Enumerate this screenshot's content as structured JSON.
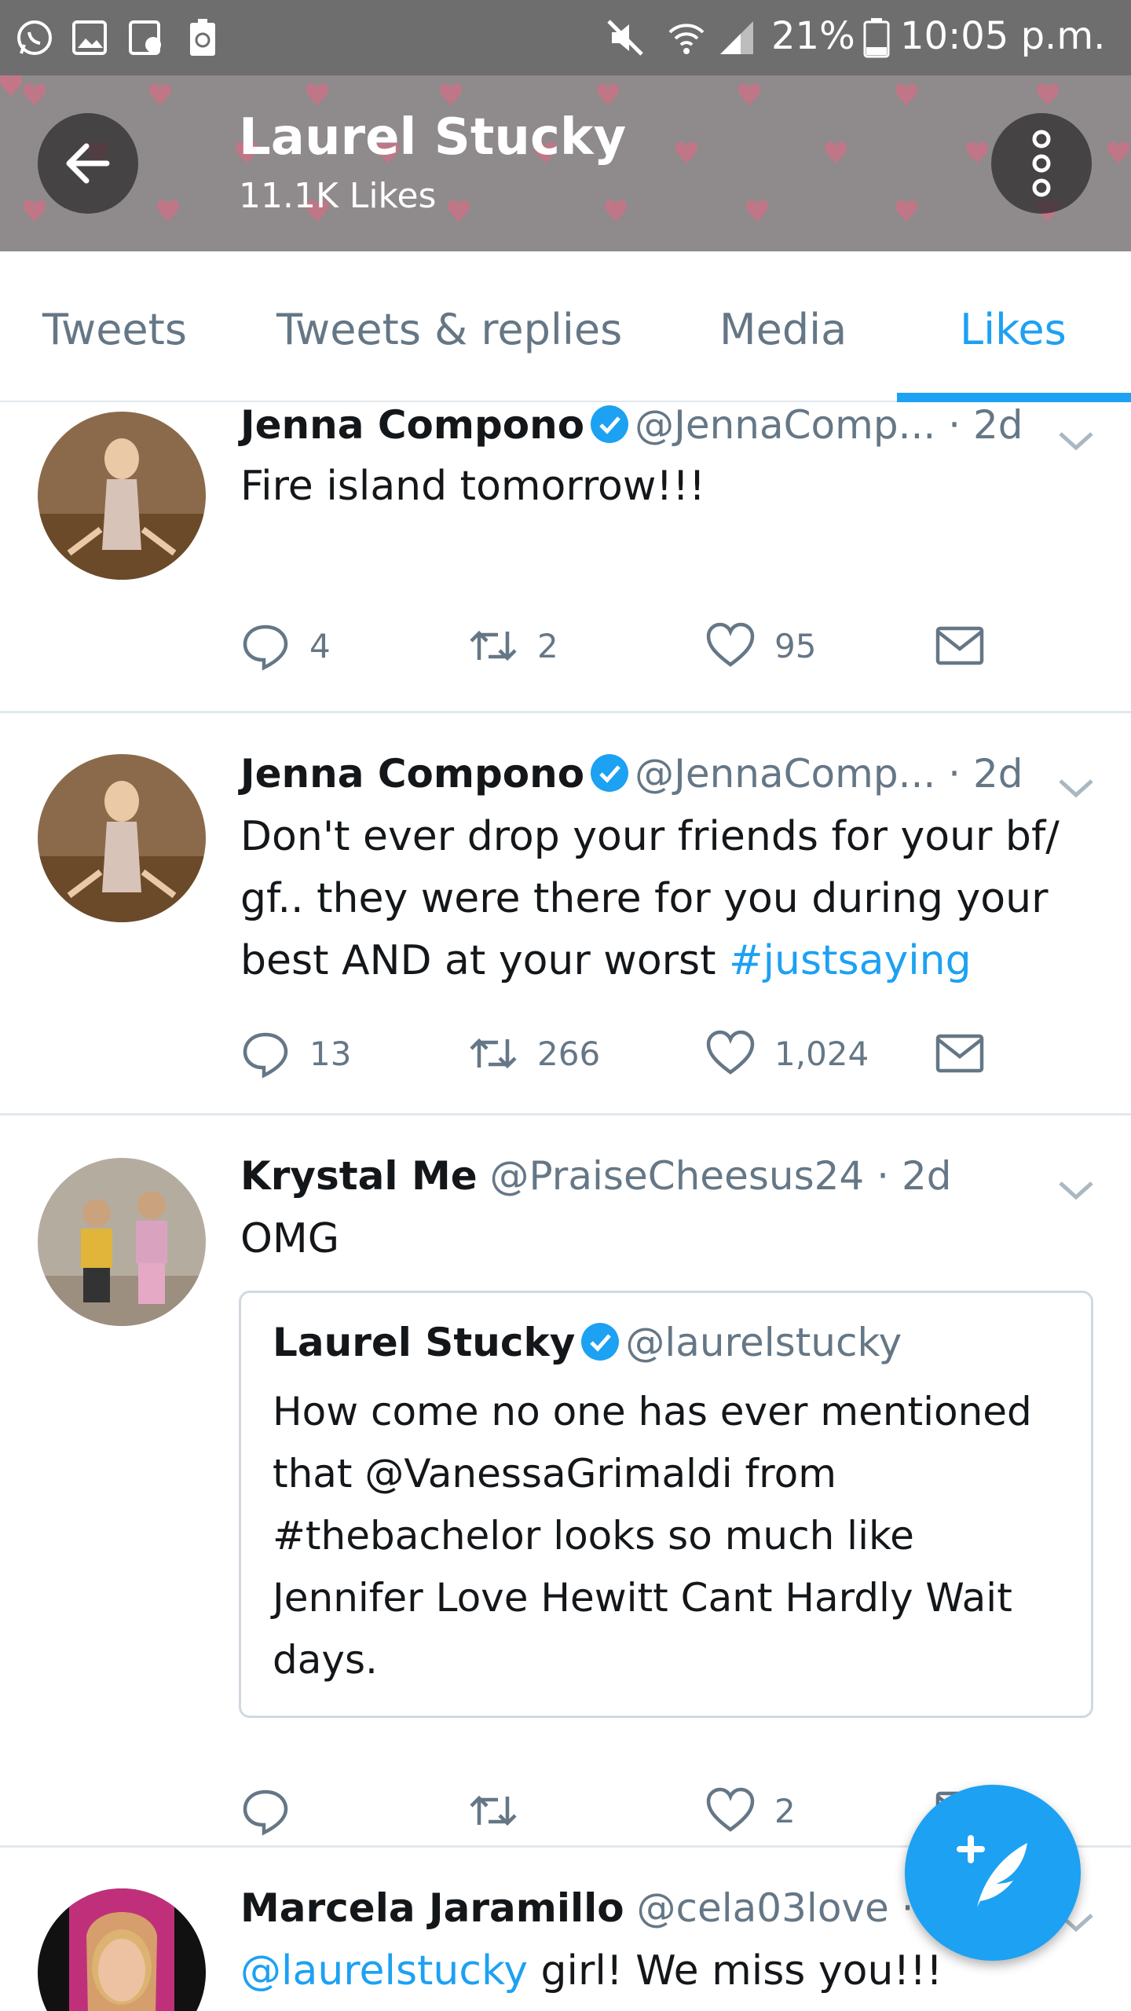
{
  "status_bar": {
    "battery": "21%",
    "time": "10:05 p.m.",
    "icons": [
      "whatsapp-icon",
      "gallery-icon",
      "clip-icon",
      "recycle-battery-icon",
      "mute-icon",
      "wifi-icon",
      "signal-icon",
      "battery-icon"
    ]
  },
  "header": {
    "title": "Laurel Stucky",
    "subtitle": "11.1K Likes",
    "back_icon": "arrow-left-icon",
    "menu_icon": "more-vertical-icon"
  },
  "tabs": [
    {
      "label": "Tweets",
      "active": false
    },
    {
      "label": "Tweets & replies",
      "active": false
    },
    {
      "label": "Media",
      "active": false
    },
    {
      "label": "Likes",
      "active": true
    }
  ],
  "accent": "#1da1f2",
  "tweets": [
    {
      "name": "Jenna Compono",
      "verified": true,
      "handle": "@JennaComp...",
      "time": "· 2d",
      "text": "Fire island tomorrow!!!",
      "replies": "4",
      "retweets": "2",
      "likes": "95"
    },
    {
      "name": "Jenna Compono",
      "verified": true,
      "handle": "@JennaComp...",
      "time": "· 2d",
      "text_part1": "Don't ever drop your friends for your bf/ gf.. they were there for you during your best AND at your worst ",
      "hashtag": "#justsaying",
      "replies": "13",
      "retweets": "266",
      "likes": "1,024"
    },
    {
      "name": "Krystal Me",
      "verified": false,
      "handle": "@PraiseCheesus24",
      "time": "· 2d",
      "text": "OMG",
      "quote": {
        "name": "Laurel Stucky",
        "verified": true,
        "handle": "@laurelstucky",
        "text": "How come no one has ever mentioned that @VanessaGrimaldi from #thebachelor looks so much like Jennifer Love Hewitt Cant Hardly Wait days."
      },
      "replies": "",
      "retweets": "",
      "likes": "2"
    },
    {
      "name": "Marcela Jaramillo",
      "verified": false,
      "handle": "@cela03love",
      "time": "·",
      "mention": "@laurelstucky",
      "text_rest": " girl! We miss you!!!"
    }
  ],
  "fab": {
    "icon": "compose-tweet-icon"
  }
}
